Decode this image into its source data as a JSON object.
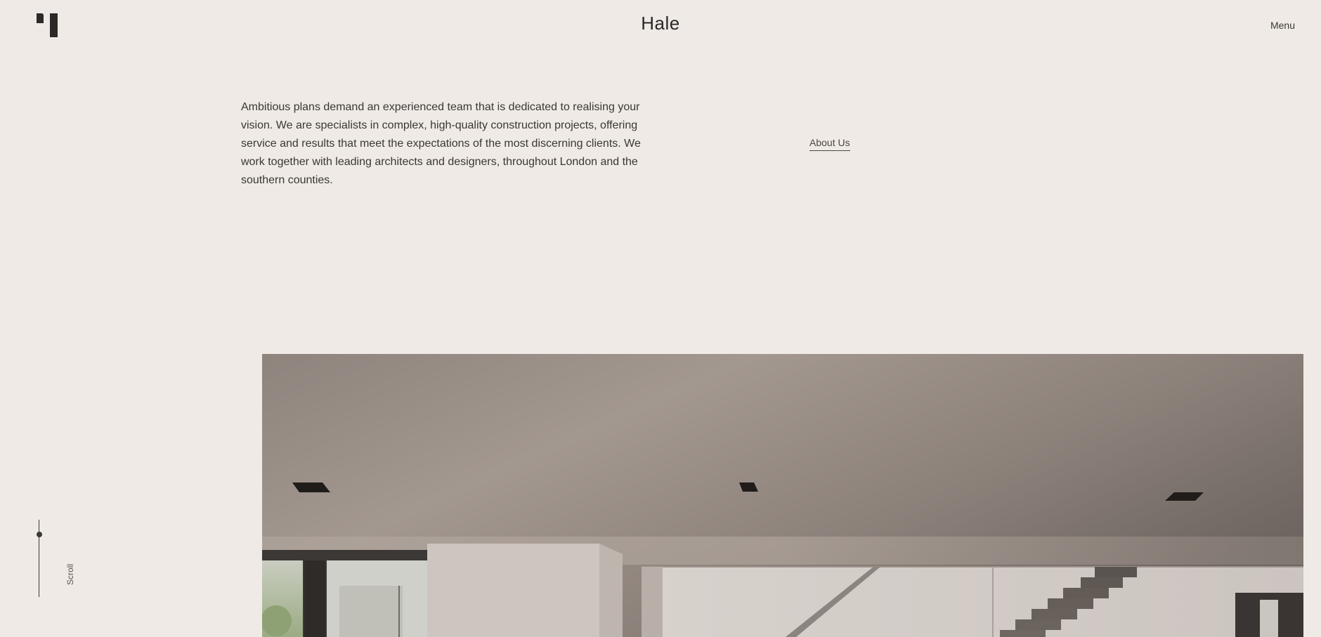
{
  "header": {
    "brand": "Hale",
    "menu_label": "Menu",
    "logo_icon": "hale-logo-icon"
  },
  "intro": {
    "text": "Ambitious plans demand an experienced team that is dedicated to realising your vision. We are specialists in complex, high-quality construction projects, offering service and results that meet the expectations of the most discerning clients. We work together with leading architects and designers, throughout London and the southern counties.",
    "link_label": "About Us"
  },
  "scroll": {
    "label": "Scroll"
  },
  "colors": {
    "background": "#efeae5",
    "text": "#2c2a28",
    "accent": "#3a3734"
  }
}
